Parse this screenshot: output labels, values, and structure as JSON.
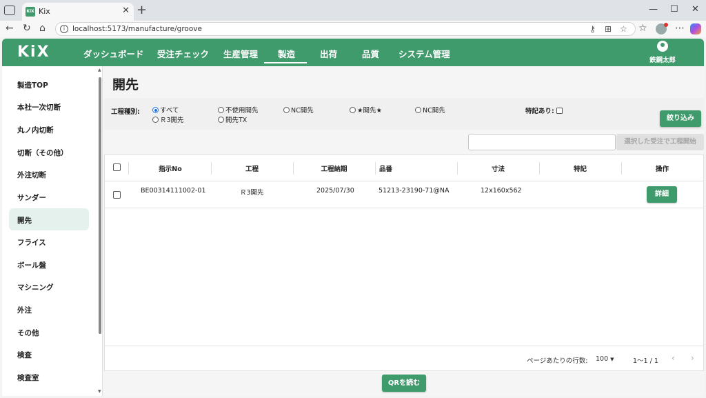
{
  "browser": {
    "tab_title": "Kix",
    "tab_favicon_text": "KiX",
    "url": "localhost:5173/manufacture/groove"
  },
  "header": {
    "logo": "KiX",
    "nav": [
      {
        "label": "ダッシュボード",
        "active": false
      },
      {
        "label": "受注チェック",
        "active": false
      },
      {
        "label": "生産管理",
        "active": false
      },
      {
        "label": "製造",
        "active": true
      },
      {
        "label": "出荷",
        "active": false
      },
      {
        "label": "品質",
        "active": false
      },
      {
        "label": "システム管理",
        "active": false
      }
    ],
    "user_name": "鉄鋼太郎"
  },
  "sidebar": {
    "items": [
      {
        "label": "製造TOP",
        "active": false
      },
      {
        "label": "本社一次切断",
        "active": false
      },
      {
        "label": "丸ノ内切断",
        "active": false
      },
      {
        "label": "切断（その他）",
        "active": false
      },
      {
        "label": "外注切断",
        "active": false
      },
      {
        "label": "サンダー",
        "active": false
      },
      {
        "label": "開先",
        "active": true
      },
      {
        "label": "フライス",
        "active": false
      },
      {
        "label": "ボール盤",
        "active": false
      },
      {
        "label": "マシニング",
        "active": false
      },
      {
        "label": "外注",
        "active": false
      },
      {
        "label": "その他",
        "active": false
      },
      {
        "label": "検査",
        "active": false
      },
      {
        "label": "検査室",
        "active": false
      }
    ]
  },
  "main": {
    "title": "開先",
    "filter": {
      "label": "工程種別:",
      "options": [
        {
          "label": "すべて",
          "checked": true
        },
        {
          "label": "不使用開先",
          "checked": false
        },
        {
          "label": "NC開先",
          "checked": false
        },
        {
          "label": "★開先★",
          "checked": false
        },
        {
          "label": "NC開先",
          "checked": false
        },
        {
          "label": "Ｒ3開先",
          "checked": false
        },
        {
          "label": "開先TX",
          "checked": false
        }
      ],
      "special_label": "特記あり:",
      "special_checked": false,
      "button_label": "絞り込み"
    },
    "search": {
      "value": "",
      "placeholder": ""
    },
    "start_button_label": "選択した受注で工程開始",
    "table": {
      "columns": [
        "指示No",
        "工程",
        "工程納期",
        "品番",
        "寸法",
        "特記",
        "操作"
      ],
      "rows": [
        {
          "instruction_no": "BE00314111002-01",
          "process": "Ｒ3開先",
          "due_date": "2025/07/30",
          "part_no": "51213-23190-71@NA",
          "size": "12x160x562",
          "note": "",
          "action_label": "詳細"
        }
      ],
      "footer": {
        "rows_per_page_label": "ページあたりの行数:",
        "rows_per_page": "100",
        "range": "1〜1 / 1"
      }
    },
    "qr_button_label": "QRを読む"
  },
  "colors": {
    "brand": "#3f9a6c",
    "active_sidebar": "#e4f1ec",
    "radio_accent": "#1a73e8"
  }
}
